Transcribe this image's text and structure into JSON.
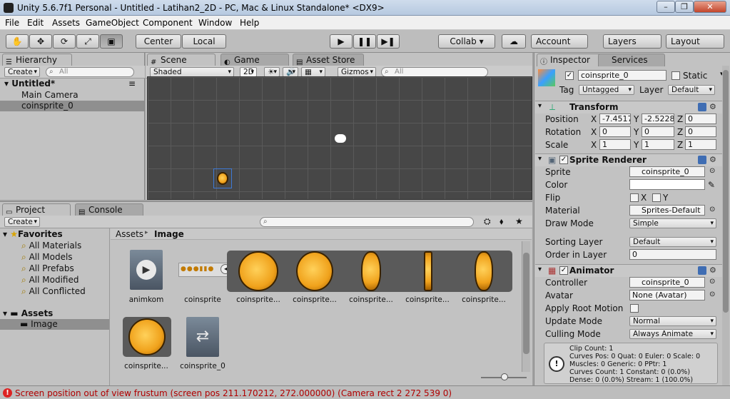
{
  "window": {
    "title": "Unity 5.6.7f1 Personal - Untitled - Latihan2_2D - PC, Mac & Linux Standalone* <DX9>",
    "min": "–",
    "max": "❐",
    "close": "✕"
  },
  "menu": [
    "File",
    "Edit",
    "Assets",
    "GameObject",
    "Component",
    "Window",
    "Help"
  ],
  "toolbar": {
    "hand": "✋",
    "move": "✥",
    "rotate": "⟳",
    "scale": "⤢",
    "rect": "▣",
    "center": "Center",
    "local": "Local",
    "play": "▶",
    "pause": "❚❚",
    "step": "▶❚",
    "collab": "Collab ▾",
    "cloud": "☁",
    "account": "Account",
    "layers": "Layers",
    "layout": "Layout"
  },
  "hierarchy": {
    "tab": "Hierarchy",
    "create": "Create",
    "search": "All",
    "scene": "Untitled*",
    "items": [
      "Main Camera",
      "coinsprite_0"
    ]
  },
  "scene_view": {
    "tabs": [
      "Scene",
      "Game",
      "Asset Store"
    ],
    "shading": "Shaded",
    "mode2d": "2D",
    "light": "☀",
    "audio": "🔊",
    "fx": "▦",
    "gizmos": "Gizmos",
    "search": "All"
  },
  "project": {
    "tabs": [
      "Project",
      "Console"
    ],
    "create": "Create",
    "favorites_label": "Favorites",
    "favorites": [
      "All Materials",
      "All Models",
      "All Prefabs",
      "All Modified",
      "All Conflicted"
    ],
    "assets_label": "Assets",
    "folders": [
      "Image"
    ],
    "breadcrumb": [
      "Assets",
      "Image"
    ],
    "assets": [
      "animkom",
      "coinsprite",
      "coinsprite...",
      "coinsprite...",
      "coinsprite...",
      "coinsprite...",
      "coinsprite...",
      "coinsprite...",
      "coinsprite_0"
    ]
  },
  "inspector": {
    "tabs": [
      "Inspector",
      "Services"
    ],
    "object_name": "coinsprite_0",
    "static": "Static",
    "tag_label": "Tag",
    "tag": "Untagged",
    "layer_label": "Layer",
    "layer": "Default",
    "transform": {
      "title": "Transform",
      "rows": [
        {
          "label": "Position",
          "x": "-7.4517",
          "y": "-2.5228",
          "z": "0"
        },
        {
          "label": "Rotation",
          "x": "0",
          "y": "0",
          "z": "0"
        },
        {
          "label": "Scale",
          "x": "1",
          "y": "1",
          "z": "1"
        }
      ]
    },
    "sprite_renderer": {
      "title": "Sprite Renderer",
      "sprite_label": "Sprite",
      "sprite": "coinsprite_0",
      "color_label": "Color",
      "flip_label": "Flip",
      "flip_x": "X",
      "flip_y": "Y",
      "material_label": "Material",
      "material": "Sprites-Default",
      "draw_mode_label": "Draw Mode",
      "draw_mode": "Simple",
      "sorting_layer_label": "Sorting Layer",
      "sorting_layer": "Default",
      "order_label": "Order in Layer",
      "order": "0"
    },
    "animator": {
      "title": "Animator",
      "controller_label": "Controller",
      "controller": "coinsprite_0",
      "avatar_label": "Avatar",
      "avatar": "None (Avatar)",
      "root_motion_label": "Apply Root Motion",
      "update_label": "Update Mode",
      "update": "Normal",
      "culling_label": "Culling Mode",
      "culling": "Always Animate",
      "info": [
        "Clip Count: 1",
        "Curves Pos: 0 Quat: 0 Euler: 0 Scale: 0",
        "Muscles: 0 Generic: 0 PPtr: 1",
        "Curves Count: 1 Constant: 0 (0.0%)",
        "Dense: 0 (0.0%) Stream: 1 (100.0%)"
      ]
    }
  },
  "status": {
    "message": "Screen position out of view frustum (screen pos 211.170212, 272.000000) (Camera rect 2 272 539 0)"
  }
}
